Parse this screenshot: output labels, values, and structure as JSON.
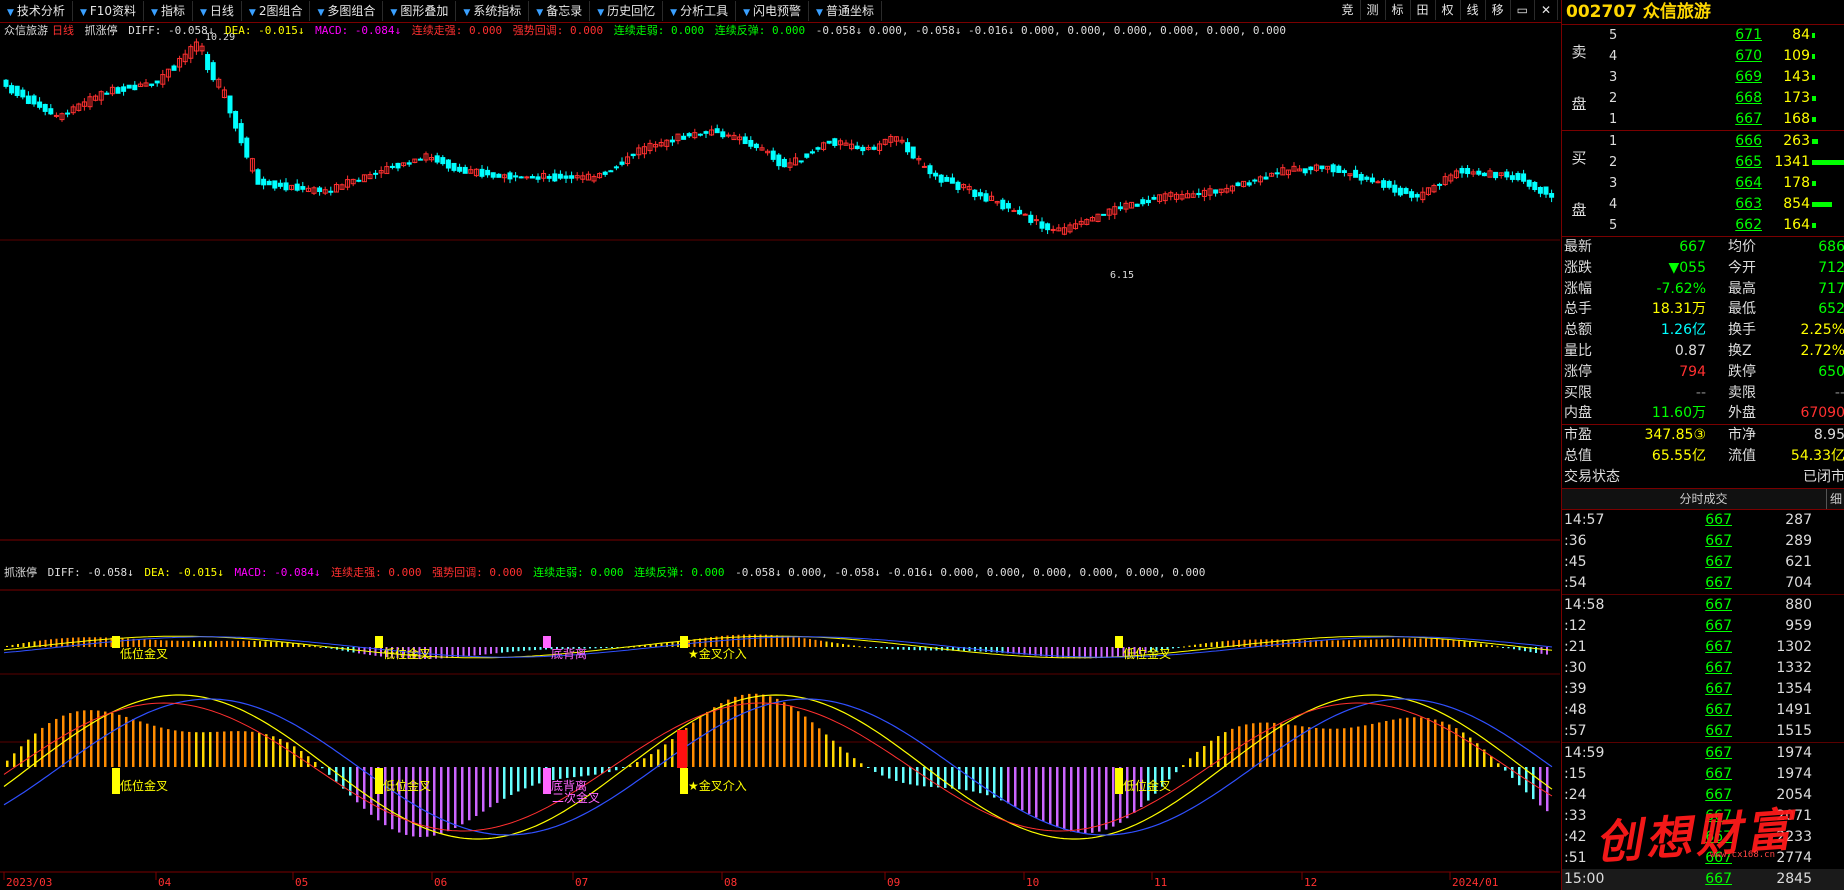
{
  "toolbar": {
    "items": [
      "技术分析",
      "F10资料",
      "指标",
      "日线",
      "2图组合",
      "多图组合",
      "图形叠加",
      "系统指标",
      "备忘录",
      "历史回忆",
      "分析工具",
      "闪电预警",
      "普通坐标"
    ],
    "right": [
      "竞",
      "测",
      "标",
      "田",
      "权",
      "线",
      "移",
      "▭",
      "✕"
    ]
  },
  "legend_top": {
    "name": "众信旅游",
    "period": "日线",
    "indicator": "抓涨停",
    "diff": "DIFF: -0.058↓",
    "dea": "DEA: -0.015↓",
    "macd": "MACD: -0.084↓",
    "s1": "连续走强: 0.000",
    "s2": "强势回调: 0.000",
    "s3": "连续走弱: 0.000",
    "s4": "连续反弹: 0.000",
    "tail": "-0.058↓  0.000, -0.058↓  -0.016↓  0.000, 0.000, 0.000, 0.000, 0.000, 0.000"
  },
  "legend_bottom": {
    "indicator": "抓涨停",
    "diff": "DIFF: -0.058↓",
    "dea": "DEA: -0.015↓",
    "macd": "MACD: -0.084↓",
    "s1": "连续走强: 0.000",
    "s2": "强势回调: 0.000",
    "s3": "连续走弱: 0.000",
    "s4": "连续反弹: 0.000",
    "tail": "-0.058↓  0.000, -0.058↓  -0.016↓  0.000, 0.000, 0.000, 0.000, 0.000, 0.000"
  },
  "price_labels": {
    "high": "10.29",
    "low": "6.15"
  },
  "signal_labels": {
    "low_golden": "低位金叉",
    "bottom_div": "底背离",
    "second_gold": "二次金叉",
    "golden_in": "★金叉介入"
  },
  "x_axis": [
    "2023/03",
    "04",
    "05",
    "06",
    "07",
    "08",
    "09",
    "10",
    "11",
    "12",
    "2024/01"
  ],
  "stock": {
    "code": "002707",
    "name": "众信旅游"
  },
  "orderbook": {
    "sell_label": [
      "卖",
      "盘"
    ],
    "buy_label": [
      "买",
      "盘"
    ],
    "sell": [
      {
        "lv": "5",
        "price": "671",
        "vol": "84",
        "bar": 0.06
      },
      {
        "lv": "4",
        "price": "670",
        "vol": "109",
        "bar": 0.08
      },
      {
        "lv": "3",
        "price": "669",
        "vol": "143",
        "bar": 0.1
      },
      {
        "lv": "2",
        "price": "668",
        "vol": "173",
        "bar": 0.12
      },
      {
        "lv": "1",
        "price": "667",
        "vol": "168",
        "bar": 0.12
      }
    ],
    "buy": [
      {
        "lv": "1",
        "price": "666",
        "vol": "263",
        "bar": 0.18
      },
      {
        "lv": "2",
        "price": "665",
        "vol": "1341",
        "bar": 1.0
      },
      {
        "lv": "3",
        "price": "664",
        "vol": "178",
        "bar": 0.12
      },
      {
        "lv": "4",
        "price": "663",
        "vol": "854",
        "bar": 0.64
      },
      {
        "lv": "5",
        "price": "662",
        "vol": "164",
        "bar": 0.11
      }
    ]
  },
  "stats": [
    {
      "k": "最新",
      "v": "667",
      "vc": "#00ff00",
      "k2": "均价",
      "v2": "686",
      "v2c": "#00ff00"
    },
    {
      "k": "涨跌",
      "v": "▼055",
      "vc": "#00ff00",
      "k2": "今开",
      "v2": "712",
      "v2c": "#00ff00"
    },
    {
      "k": "涨幅",
      "v": "-7.62%",
      "vc": "#00ff00",
      "k2": "最高",
      "v2": "717",
      "v2c": "#00ff00"
    },
    {
      "k": "总手",
      "v": "18.31万",
      "vc": "#ffff00",
      "k2": "最低",
      "v2": "652",
      "v2c": "#00ff00"
    },
    {
      "k": "总额",
      "v": "1.26亿",
      "vc": "#00ffff",
      "k2": "换手",
      "v2": "2.25%",
      "v2c": "#ffff00"
    },
    {
      "k": "量比",
      "v": "0.87",
      "vc": "#dddddd",
      "k2": "换Z",
      "v2": "2.72%",
      "v2c": "#ffff00"
    },
    {
      "k": "涨停",
      "v": "794",
      "vc": "#ff3030",
      "k2": "跌停",
      "v2": "650",
      "v2c": "#00ff00"
    },
    {
      "k": "买限",
      "v": "--",
      "vc": "#888888",
      "k2": "卖限",
      "v2": "--",
      "v2c": "#888888"
    },
    {
      "k": "内盘",
      "v": "11.60万",
      "vc": "#00ff00",
      "k2": "外盘",
      "v2": "67090",
      "v2c": "#ff3030"
    },
    {
      "k": "市盈",
      "v": "347.85③",
      "vc": "#ffff00",
      "k2": "市净",
      "v2": "8.95",
      "v2c": "#dddddd"
    },
    {
      "k": "总值",
      "v": "65.55亿",
      "vc": "#ffff00",
      "k2": "流值",
      "v2": "54.33亿",
      "v2c": "#ffff00"
    },
    {
      "k": "交易状态",
      "v": "",
      "vc": "#dddddd",
      "k2": "",
      "v2": "已闭市",
      "v2c": "#dddddd"
    }
  ],
  "trades_title": "分时成交",
  "trades_fine": "细",
  "trades": [
    {
      "t": "14:57",
      "p": "667",
      "q": "287",
      "sep": true
    },
    {
      "t": ":36",
      "p": "667",
      "q": "289"
    },
    {
      "t": ":45",
      "p": "667",
      "q": "621"
    },
    {
      "t": ":54",
      "p": "667",
      "q": "704"
    },
    {
      "t": "14:58",
      "p": "667",
      "q": "880",
      "sep": true
    },
    {
      "t": ":12",
      "p": "667",
      "q": "959"
    },
    {
      "t": ":21",
      "p": "667",
      "q": "1302"
    },
    {
      "t": ":30",
      "p": "667",
      "q": "1332"
    },
    {
      "t": ":39",
      "p": "667",
      "q": "1354"
    },
    {
      "t": ":48",
      "p": "667",
      "q": "1491"
    },
    {
      "t": ":57",
      "p": "667",
      "q": "1515"
    },
    {
      "t": "14:59",
      "p": "667",
      "q": "1974",
      "sep": true
    },
    {
      "t": ":15",
      "p": "667",
      "q": "1974"
    },
    {
      "t": ":24",
      "p": "667",
      "q": "2054"
    },
    {
      "t": ":33",
      "p": "667",
      "q": "2071"
    },
    {
      "t": ":42",
      "p": "667",
      "q": "2233"
    },
    {
      "t": ":51",
      "p": "667",
      "q": "2774"
    },
    {
      "t": "15:00",
      "p": "667",
      "q": "2845"
    }
  ],
  "watermark": "创想财富",
  "watermark_url": "www.cx168.cn"
}
